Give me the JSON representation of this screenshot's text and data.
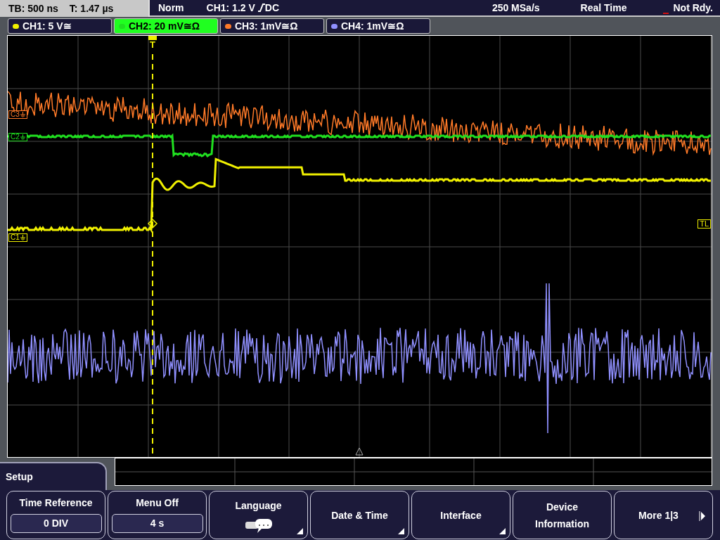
{
  "status_bar": {
    "timebase": "TB: 500 ns",
    "trigger_time": "T: 1.47 µs",
    "mode": "Norm",
    "trigger": "CH1: 1.2 V",
    "coupling": "DC",
    "sample_rate": "250 MSa/s",
    "acquisition": "Real Time",
    "state": "Not Rdy."
  },
  "channels": [
    {
      "label": "CH1: 5 V≅",
      "color": "#f0f000",
      "selected": false
    },
    {
      "label": "CH2: 20 mV≅Ω",
      "color": "#20e020",
      "selected": true
    },
    {
      "label": "CH3: 1mV≅Ω",
      "color": "#ff7a28",
      "selected": false
    },
    {
      "label": "CH4: 1mV≅Ω",
      "color": "#9090ff",
      "selected": false
    }
  ],
  "markers": [
    {
      "label": "C3",
      "color": "#ff7a28"
    },
    {
      "label": "C2",
      "color": "#20e020"
    },
    {
      "label": "C1",
      "color": "#f0f000"
    }
  ],
  "trigger_marker": "T",
  "trigger_level_marker": "TL",
  "menu": {
    "title": "Setup",
    "softkeys": [
      {
        "label": "Time Reference",
        "kind": "value",
        "value": "0 DIV",
        "submenu": false
      },
      {
        "label": "Menu Off",
        "kind": "value",
        "value": "4 s",
        "submenu": false
      },
      {
        "label": "Language",
        "kind": "icon",
        "submenu": true
      },
      {
        "label": "Date & Time",
        "kind": "plain",
        "submenu": true
      },
      {
        "label": "Interface",
        "kind": "plain",
        "submenu": true
      },
      {
        "label": "Device Information",
        "kind": "plain",
        "submenu": false
      },
      {
        "label": "More 1|3",
        "kind": "next",
        "submenu": false
      }
    ]
  }
}
